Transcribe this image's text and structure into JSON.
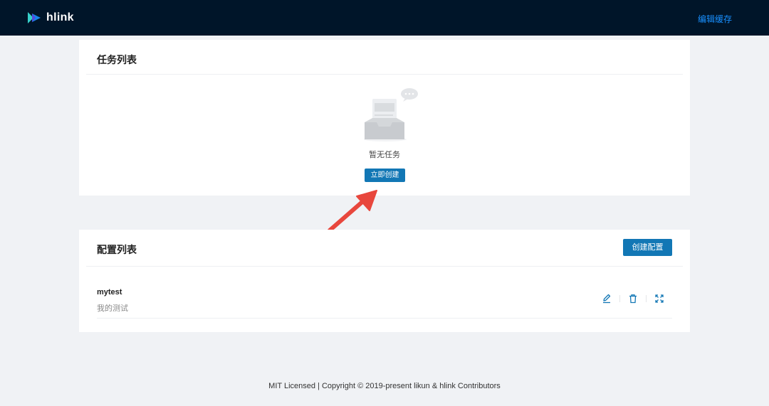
{
  "app": {
    "name": "hlink"
  },
  "header": {
    "edit_cache_label": "编辑缓存"
  },
  "tasks": {
    "title": "任务列表",
    "empty_text": "暂无任务",
    "create_now_label": "立即创建"
  },
  "configs": {
    "title": "配置列表",
    "create_label": "创建配置",
    "items": [
      {
        "name": "mytest",
        "description": "我的测试"
      }
    ]
  },
  "colors": {
    "topbar": "#001529",
    "primary": "#1277b5",
    "link": "#1890ff",
    "annotation_arrow": "#e8473d"
  },
  "icons": {
    "logo": "hlink-logo-icon",
    "empty": "empty-inbox-icon",
    "arrow": "annotation-arrow-icon",
    "edit": "edit-icon",
    "delete": "delete-icon",
    "expand": "expand-icon"
  },
  "footer": {
    "text": "MIT Licensed | Copyright © 2019-present likun & hlink Contributors"
  }
}
